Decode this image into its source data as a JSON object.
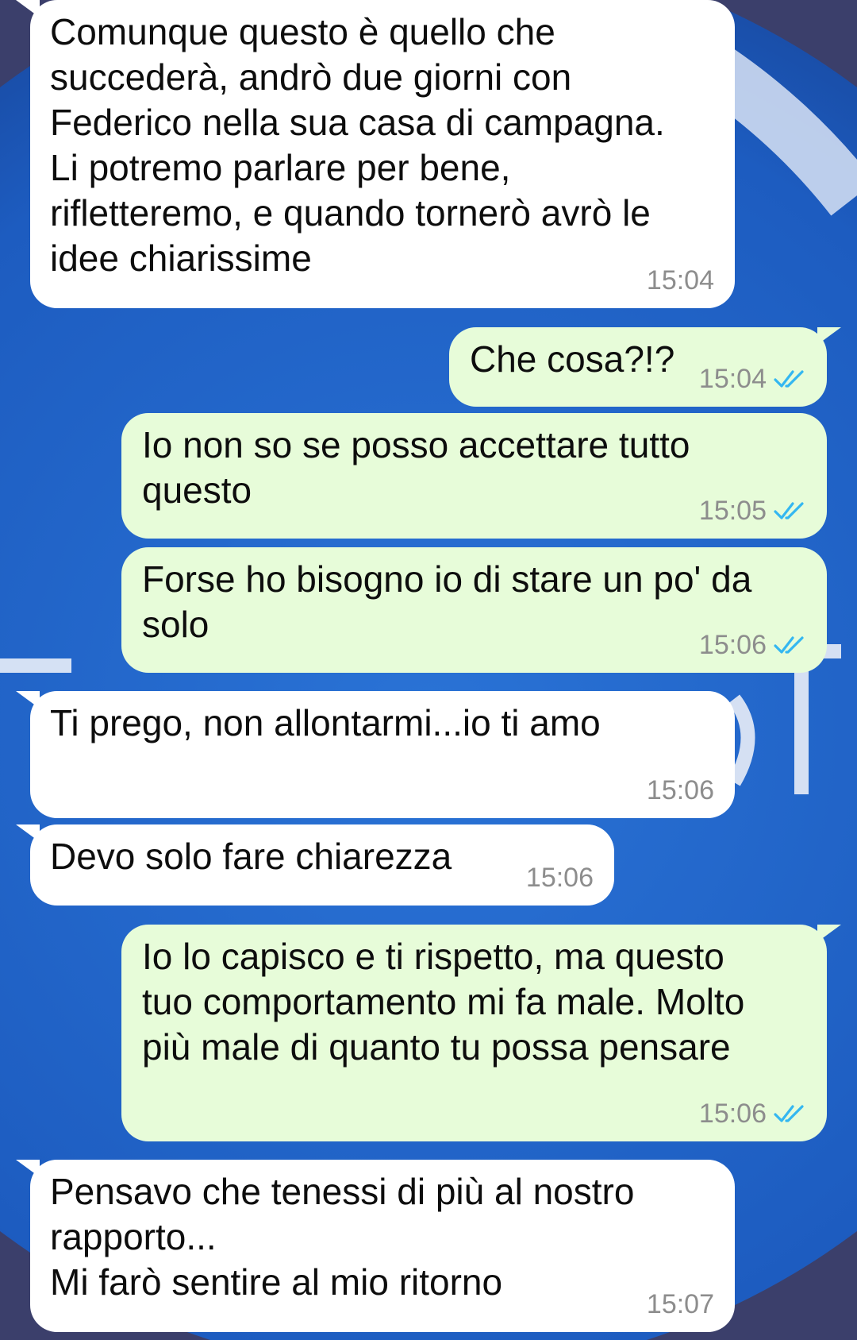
{
  "messages": [
    {
      "direction": "incoming",
      "text": "Comunque questo è quello che\nsuccederà, andrò due giorni con\nFederico nella sua casa di campagna.\nLi potremo parlare per bene,\nrifletteremo, e quando tornerò avrò le\nidee chiarissime",
      "time": "15:04"
    },
    {
      "direction": "outgoing",
      "text": "Che cosa?!?",
      "time": "15:04",
      "status": "read"
    },
    {
      "direction": "outgoing",
      "text": "Io non so se posso accettare tutto\nquesto",
      "time": "15:05",
      "status": "read"
    },
    {
      "direction": "outgoing",
      "text": "Forse ho bisogno io di stare un po' da\nsolo",
      "time": "15:06",
      "status": "read"
    },
    {
      "direction": "incoming",
      "text": "Ti prego, non allontarmi...io ti amo",
      "time": "15:06"
    },
    {
      "direction": "incoming",
      "text": "Devo solo fare chiarezza",
      "time": "15:06"
    },
    {
      "direction": "outgoing",
      "text": "Io lo capisco e ti rispetto, ma questo\ntuo comportamento mi fa male. Molto\npiù male di quanto tu possa pensare",
      "time": "15:06",
      "status": "read"
    },
    {
      "direction": "incoming",
      "text": "Pensavo che tenessi di più al nostro\nrapporto...\nMi farò sentire al mio ritorno",
      "time": "15:07"
    }
  ],
  "colors": {
    "wallpaper_blue": "#1f5fc3",
    "incoming_bubble": "#ffffff",
    "outgoing_bubble": "#e7fcd9",
    "timestamp": "#8d8d8d",
    "read_ticks": "#34b7f1"
  },
  "icons": {
    "read_status": "double-check-icon"
  }
}
